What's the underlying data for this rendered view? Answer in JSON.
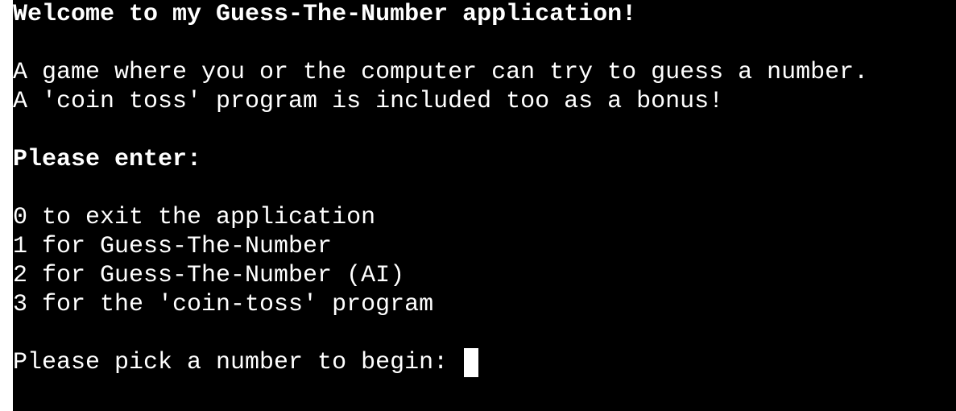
{
  "terminal": {
    "background": "#000000",
    "foreground": "#ffffff",
    "welcome": "Welcome to my Guess-The-Number application!",
    "description": [
      "A game where you or the computer can try to guess a number.",
      "A 'coin toss' program is included too as a bonus!"
    ],
    "please_enter": "Please enter:",
    "options": [
      "0 to exit the application",
      "1 for Guess-The-Number",
      "2 for Guess-The-Number (AI)",
      "3 for the 'coin-toss' program"
    ],
    "prompt": "Please pick a number to begin: ",
    "input_value": ""
  }
}
